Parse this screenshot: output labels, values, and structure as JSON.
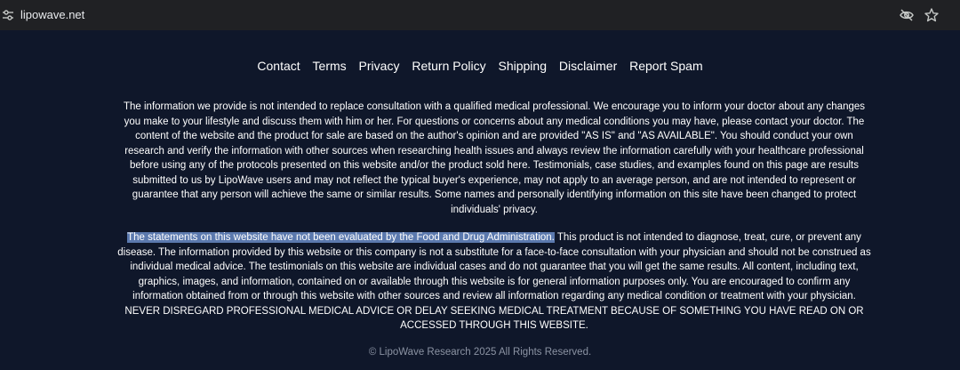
{
  "browser": {
    "url": "lipowave.net"
  },
  "footer": {
    "links": [
      "Contact",
      "Terms",
      "Privacy",
      "Return Policy",
      "Shipping",
      "Disclaimer",
      "Report Spam"
    ],
    "disclaimer_1": "The information we provide is not intended to replace consultation with a qualified medical professional. We encourage you to inform your doctor about any changes you make to your lifestyle and discuss them with him or her. For questions or concerns about any medical conditions you may have, please contact your doctor. The content of the website and the product for sale are based on the author's opinion and are provided \"AS IS\" and \"AS AVAILABLE\". You should conduct your own research and verify the information with other sources when researching health issues and always review the information carefully with your healthcare professional before using any of the protocols presented on this website and/or the product sold here. Testimonials, case studies, and examples found on this page are results submitted to us by LipoWave users and may not reflect the typical buyer's experience, may not apply to an average person, and are not intended to represent or guarantee that any person will achieve the same or similar results. Some names and personally identifying information on this site have been changed to protect individuals' privacy.",
    "disclaimer_2_highlighted": "The statements on this website have not been evaluated by the Food and Drug Administration.",
    "disclaimer_2_rest": " This product is not intended to diagnose, treat, cure, or prevent any disease. The information provided by this website or this company is not a substitute for a face-to-face consultation with your physician and should not be construed as individual medical advice. The testimonials on this website are individual cases and do not guarantee that you will get the same results. All content, including text, graphics, images, and information, contained on or available through this website is for general information purposes only. You are encouraged to confirm any information obtained from or through this website with other sources and review all information regarding any medical condition or treatment with your physician. NEVER DISREGARD PROFESSIONAL MEDICAL ADVICE OR DELAY SEEKING MEDICAL TREATMENT BECAUSE OF SOMETHING YOU HAVE READ ON OR ACCESSED THROUGH THIS WEBSITE.",
    "copyright": "© LipoWave Research 2025 All Rights Reserved."
  },
  "icons": {
    "site_settings": "site-settings-icon",
    "eye_slash": "eye-slash-icon",
    "star": "star-icon"
  },
  "colors": {
    "page_bg": "#0f172a",
    "address_bar_bg": "#202124",
    "highlight": "#5b79ae",
    "copyright_text": "#8b93a3"
  }
}
